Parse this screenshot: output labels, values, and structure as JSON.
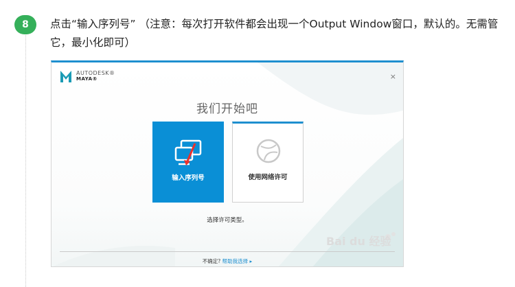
{
  "step": {
    "number": "8",
    "instruction": "点击“输入序列号” （注意：每次打开软件都会出现一个Output Window窗口，默认的。无需管它，最小化即可）"
  },
  "installer": {
    "brand_company": "AUTODESK®",
    "brand_product": "MAYA®",
    "close_symbol": "×",
    "welcome_title": "我们开始吧",
    "tiles": [
      {
        "label": "输入序列号",
        "icon": "serial-number-icon"
      },
      {
        "label": "使用网络许可",
        "icon": "network-license-icon"
      }
    ],
    "hint": "选择许可类型。",
    "footer_question": "不确定?",
    "footer_link": "帮助我选择 ▸",
    "watermark": "Bai du 经验",
    "colors": {
      "accent": "#1e8fcf",
      "serial_tile": "#0a8fd6",
      "badge": "#35b05a",
      "annotation_arrow": "#e8322d"
    }
  }
}
